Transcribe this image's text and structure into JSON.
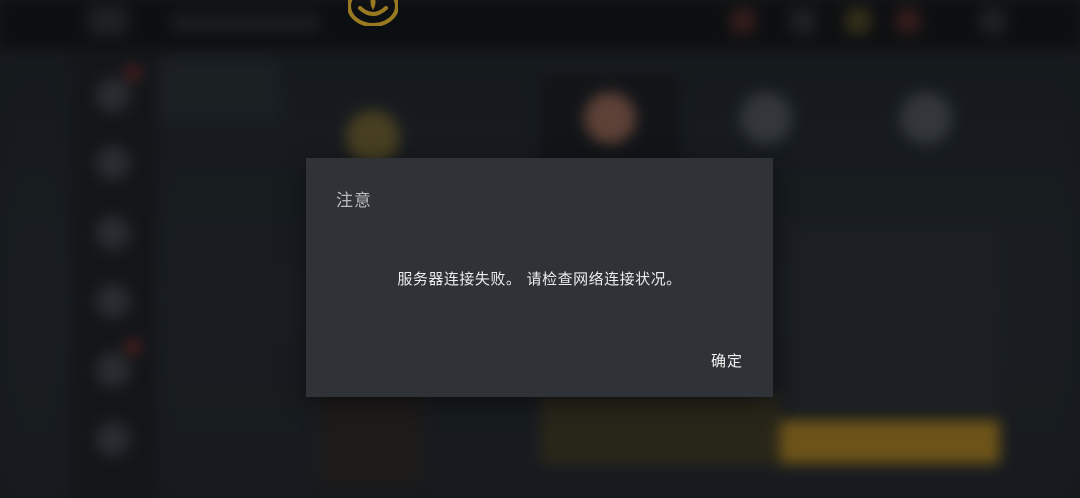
{
  "dialog": {
    "title": "注意",
    "message": "服务器连接失败。 请检查网络连接状况。",
    "ok_label": "确定"
  },
  "background": {
    "logo_icon": "lotus-logo-icon",
    "accent_color": "#e8b62c"
  }
}
